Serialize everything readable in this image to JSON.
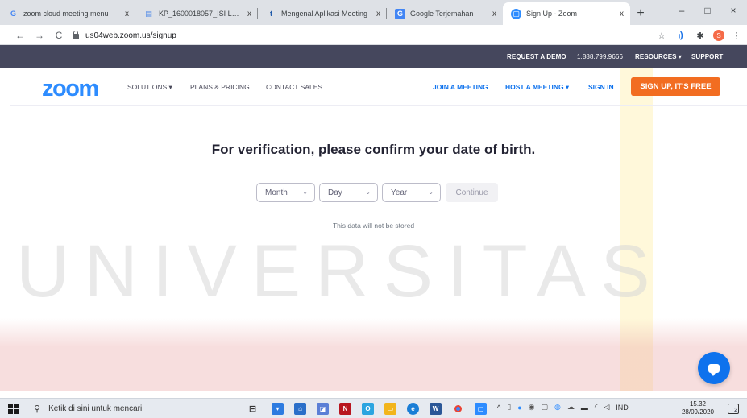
{
  "browser": {
    "tabs": [
      {
        "label": "zoom cloud meeting menu",
        "favicon": "google-icon",
        "fav_text": "G",
        "fav_color": "#4285f4",
        "active": false
      },
      {
        "label": "KP_1600018057_ISI LAPOR",
        "favicon": "doc-icon",
        "fav_text": "▤",
        "fav_color": "#4a86e8",
        "active": false
      },
      {
        "label": "Mengenal Aplikasi Meeting",
        "favicon": "tribun-icon",
        "fav_text": "t",
        "fav_color": "#1a56a8",
        "active": false
      },
      {
        "label": "Google Terjemahan",
        "favicon": "translate-icon",
        "fav_text": "G",
        "fav_color": "#4285f4",
        "active": false
      },
      {
        "label": "Sign Up - Zoom",
        "favicon": "zoom-icon",
        "fav_text": "▢",
        "fav_color": "#2d8cff",
        "active": true
      }
    ],
    "tab_close": "x",
    "new_tab": "+",
    "window_controls": {
      "minimize": "–",
      "maximize": "□",
      "close": "×"
    },
    "url": "us04web.zoom.us/signup",
    "nav": {
      "back": "←",
      "forward": "→",
      "reload": "C"
    },
    "extensions": {
      "star": "☆",
      "ext1": "ᵢ)",
      "puzzle": "✱",
      "profile": "S",
      "menu": "⋮"
    }
  },
  "zoom": {
    "topbar": {
      "request_demo": "REQUEST A DEMO",
      "phone": "1.888.799.9666",
      "resources": "RESOURCES ▾",
      "support": "SUPPORT"
    },
    "logo": "zoom",
    "nav": {
      "solutions": "SOLUTIONS ▾",
      "plans": "PLANS & PRICING",
      "contact": "CONTACT SALES",
      "join": "JOIN A MEETING",
      "host": "HOST A MEETING ▾",
      "signin": "SIGN IN",
      "signup": "SIGN UP, IT'S FREE"
    },
    "heading": "For verification, please confirm your date of birth.",
    "form": {
      "month": "Month",
      "day": "Day",
      "year": "Year",
      "chevron": "⌄",
      "continue": "Continue"
    },
    "note": "This data will not be stored",
    "watermark": "UNIVERSITAS"
  },
  "taskbar": {
    "search_placeholder": "Ketik di sini untuk mencari",
    "time": "15.32",
    "date": "28/09/2020",
    "lang": "IND",
    "notif_count": "2"
  }
}
